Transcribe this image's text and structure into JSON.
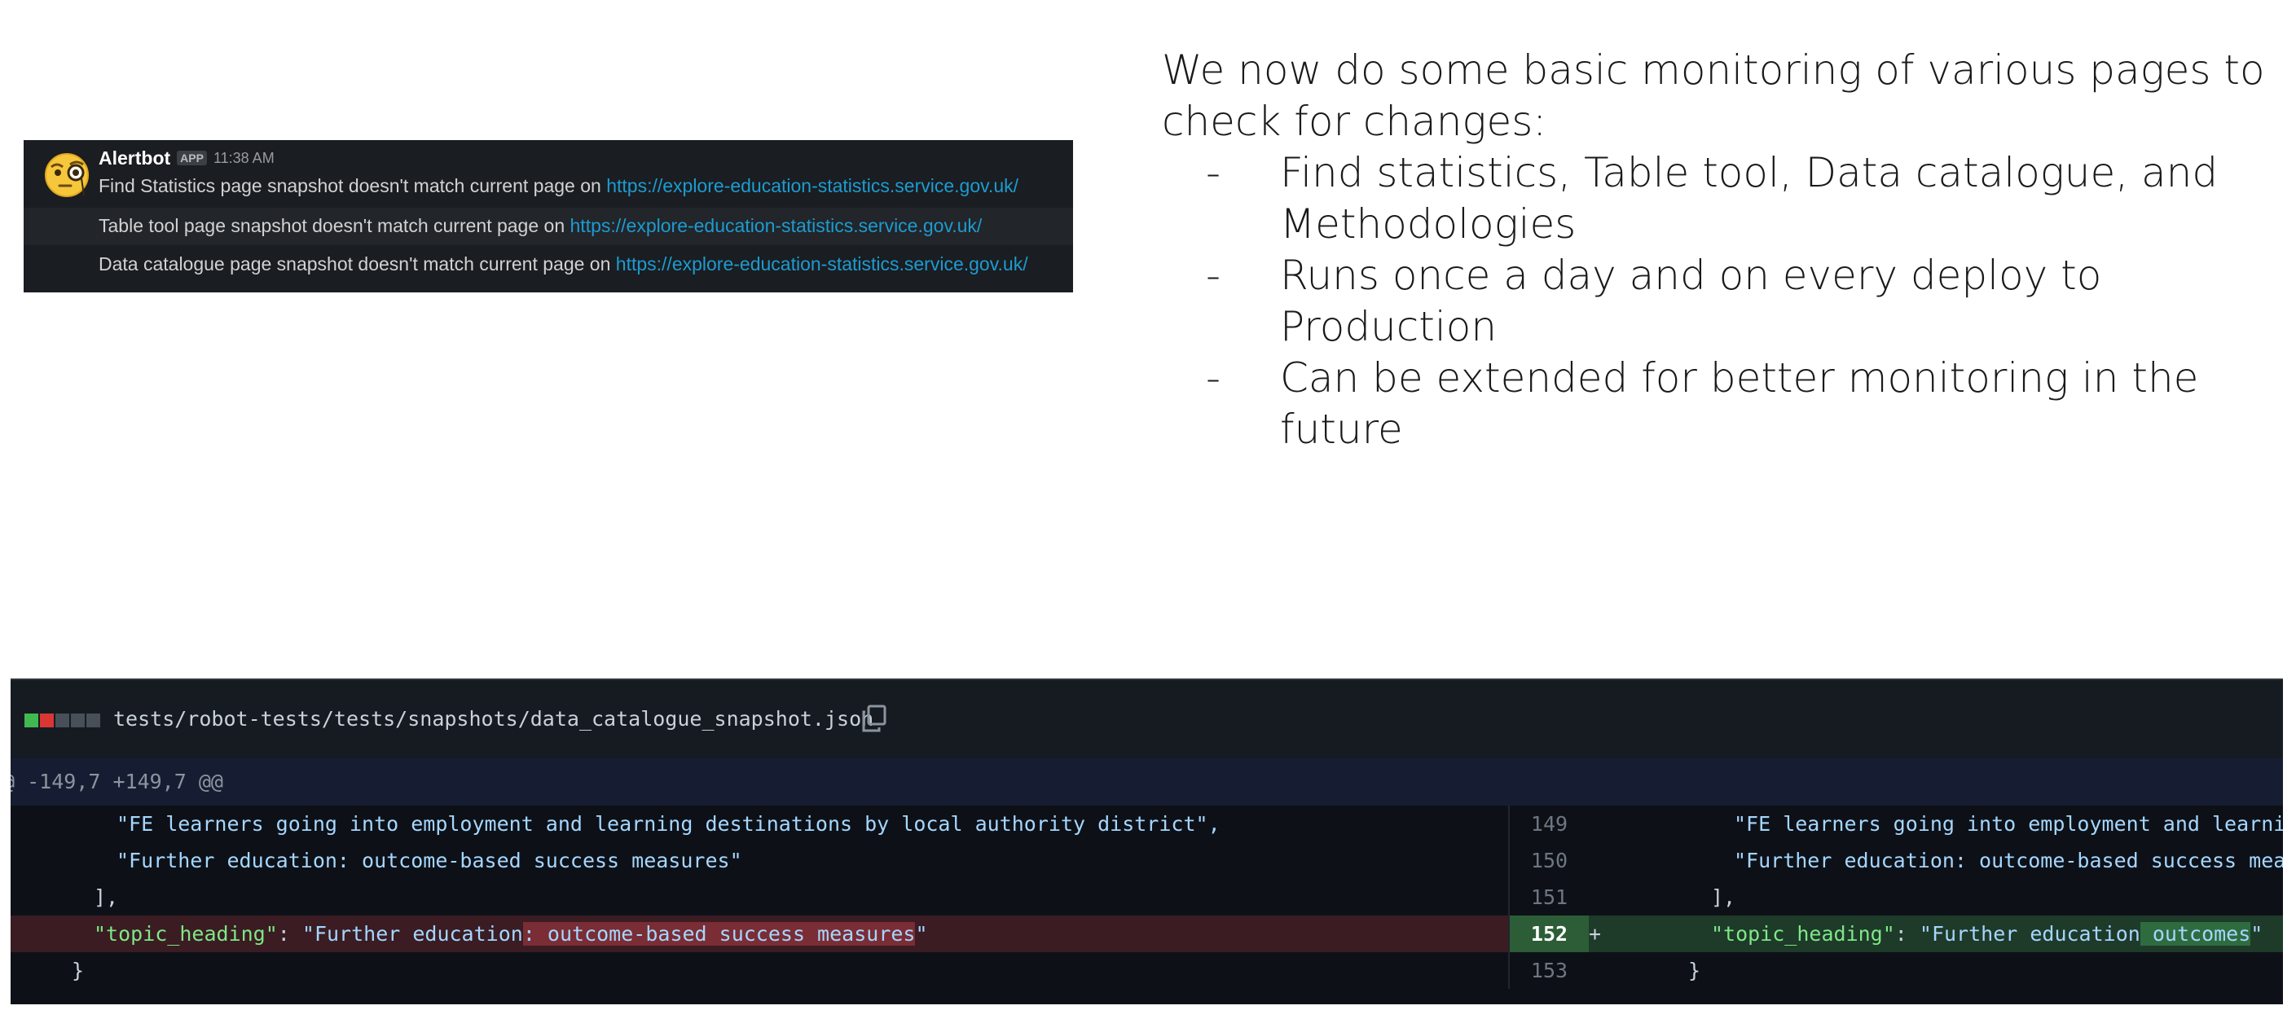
{
  "slack": {
    "bot_name": "Alertbot",
    "app_badge": "APP",
    "time": "11:38 AM",
    "avatar_icon": "monocle-face-emoji",
    "messages": [
      {
        "text": "Find Statistics page snapshot doesn't match current page on ",
        "link": "https://explore-education-statistics.service.gov.uk/"
      },
      {
        "text": "Table tool page snapshot doesn't match current page on ",
        "link": "https://explore-education-statistics.service.gov.uk/"
      },
      {
        "text": "Data catalogue page snapshot doesn't match current page on ",
        "link": "https://explore-education-statistics.service.gov.uk/"
      }
    ]
  },
  "notes": {
    "intro": "We now do some basic monitoring of various pages to check for changes:",
    "bullets": [
      {
        "dash": "-",
        "text": "Find statistics, Table tool, Data catalogue, and Methodologies"
      },
      {
        "dash": "-",
        "text": "Runs once a day and on every deploy to Production"
      },
      {
        "dash": "-",
        "text": "Can be extended for better monitoring in the future"
      }
    ]
  },
  "diff": {
    "file_path": "tests/robot-tests/tests/snapshots/data_catalogue_snapshot.json",
    "hunk_header": "@ -149,7 +149,7 @@",
    "colors": {
      "added": "#3fb950",
      "removed": "#da3633",
      "neutral": "#484f58"
    },
    "rows": [
      {
        "left": "\"FE learners going into employment and learning destinations by local authority district\",",
        "line": "149",
        "right": "\"FE learners going into employment and learnin"
      },
      {
        "left": "\"Further education: outcome-based success measures\"",
        "line": "150",
        "right": "\"Further education: outcome-based success meas"
      },
      {
        "left": "],",
        "line": "151",
        "right": "],"
      },
      {
        "left_key": "\"topic_heading\"",
        "left_sep": ": ",
        "left_val_pre": "\"Further education",
        "left_val_hl": ": outcome-based success measures",
        "left_val_post": "\"",
        "line": "152",
        "sign": "+",
        "right_key": "\"topic_heading\"",
        "right_sep": ": ",
        "right_val_pre": "\"Further education",
        "right_val_hl": " outcomes",
        "right_val_post": "\""
      },
      {
        "left": "}",
        "line": "153",
        "right": "}"
      }
    ]
  }
}
